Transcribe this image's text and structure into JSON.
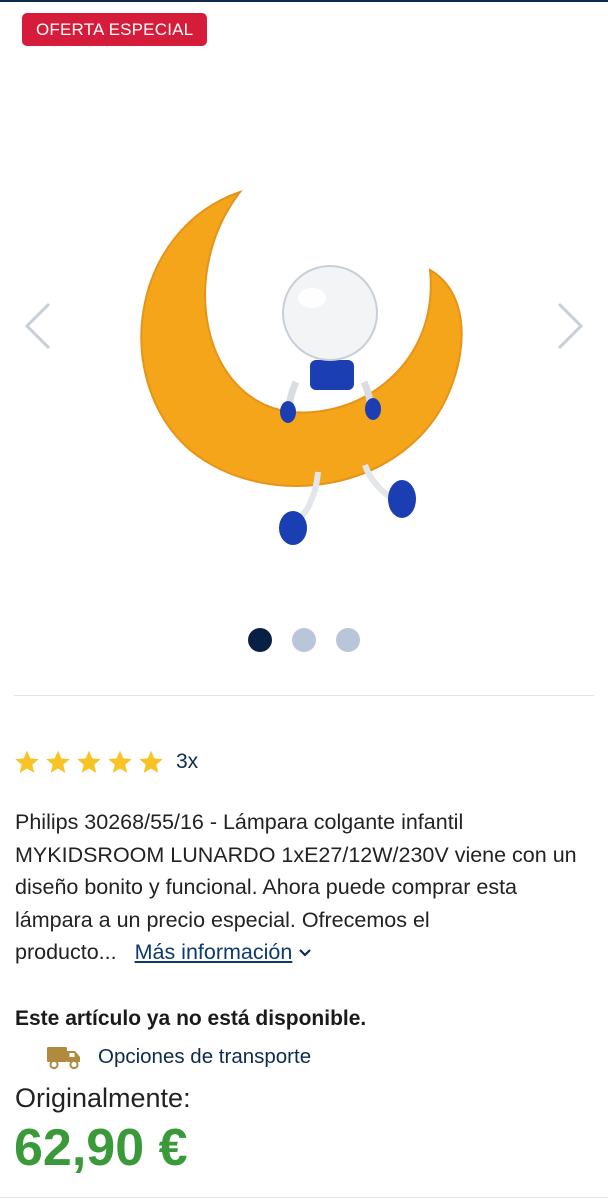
{
  "badge": {
    "label": "OFERTA ESPECIAL",
    "color": "#d61c3b"
  },
  "gallery": {
    "image_name": "moon-lamp-image",
    "prev_icon": "chevron-left-icon",
    "next_icon": "chevron-right-icon",
    "dot_count": 3,
    "active_dot": 1
  },
  "rating": {
    "stars": 5,
    "max_stars": 5,
    "count_label": "3x",
    "star_color": "#f7c325"
  },
  "product": {
    "description": "Philips 30268/55/16 - Lámpara colgante infantil MYKIDSROOM LUNARDO 1xE27/12W/230V viene con un diseño bonito y funcional. Ahora puede comprar esta lámpara a un precio especial. Ofrecemos el producto...",
    "more_info_label": "Más información",
    "more_info_icon": "chevron-down-icon"
  },
  "availability": {
    "status_text": "Este artículo ya no está disponible."
  },
  "shipping": {
    "icon": "truck-icon",
    "label": "Opciones de transporte"
  },
  "pricing": {
    "original_label": "Originalmente:",
    "price": "62,90 €",
    "price_color": "#3a9a3a"
  }
}
